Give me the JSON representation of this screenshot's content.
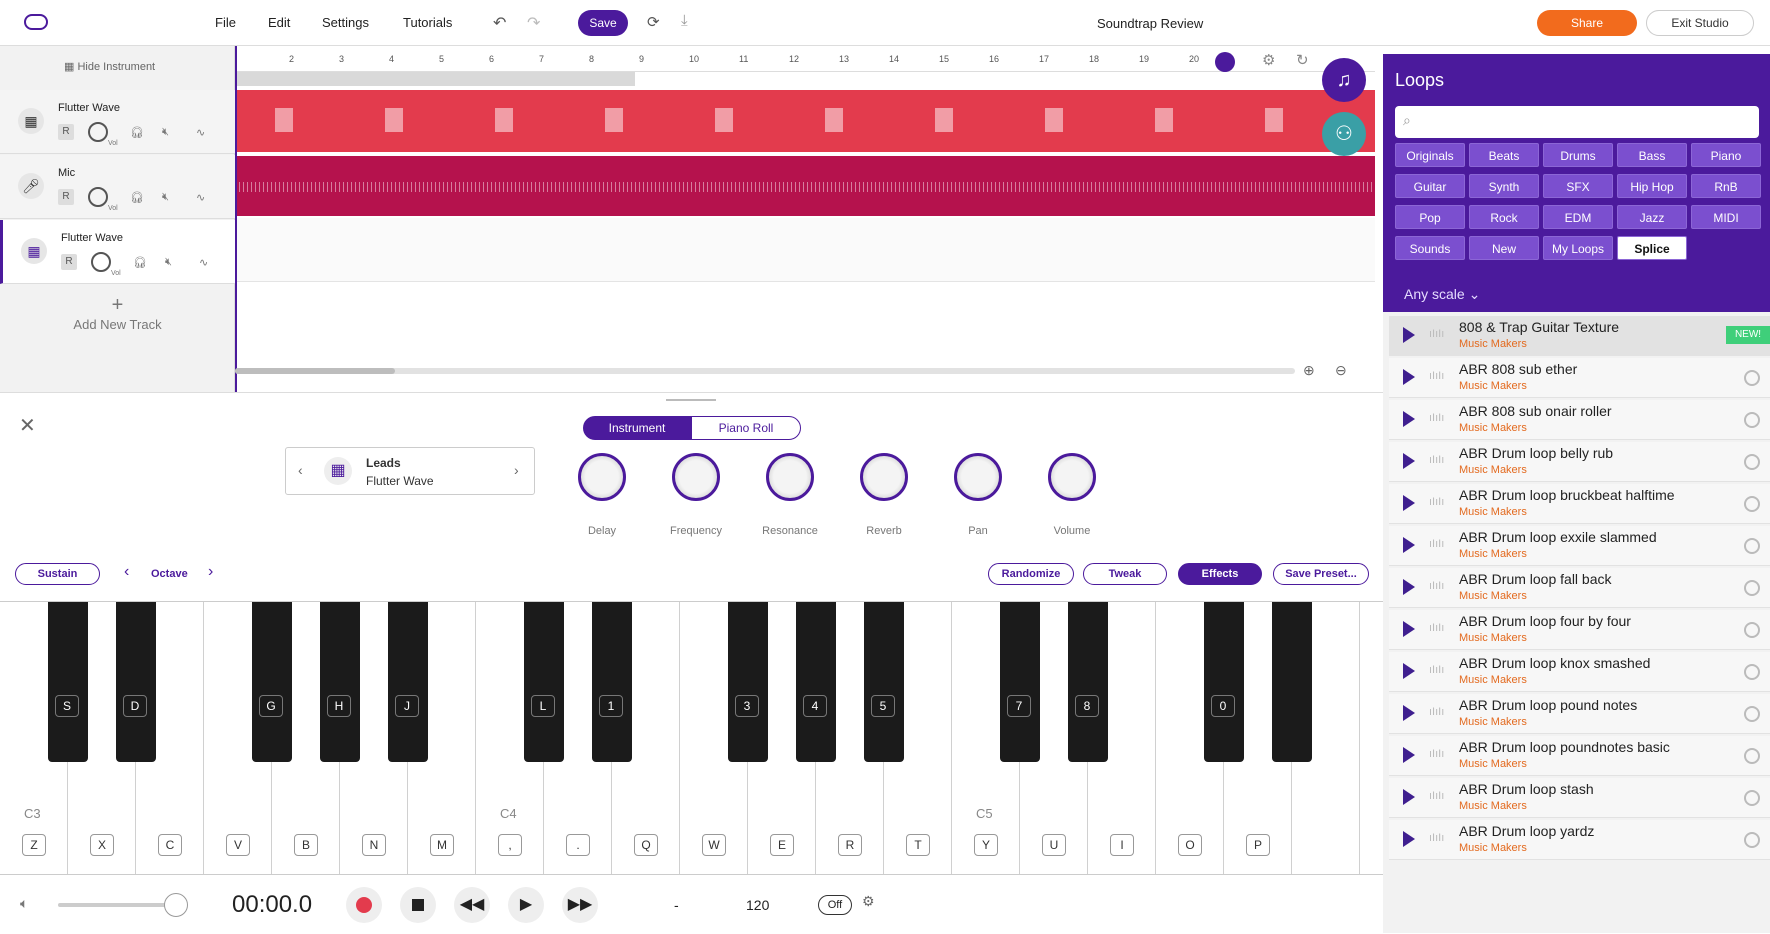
{
  "menu": {
    "file": "File",
    "edit": "Edit",
    "settings": "Settings",
    "tutorials": "Tutorials",
    "save": "Save"
  },
  "project_title": "Soundtrap Review",
  "header_buttons": {
    "share": "Share",
    "exit": "Exit Studio"
  },
  "tracks": {
    "hide_instrument": "Hide Instrument",
    "items": [
      {
        "name": "Flutter Wave",
        "r": "R",
        "vol": "Vol"
      },
      {
        "name": "Mic",
        "r": "R",
        "vol": "Vol"
      },
      {
        "name": "Flutter Wave",
        "r": "R",
        "vol": "Vol"
      }
    ],
    "add_track": "Add New Track"
  },
  "ruler": [
    "2",
    "3",
    "4",
    "5",
    "6",
    "7",
    "8",
    "9",
    "10",
    "11",
    "12",
    "13",
    "14",
    "15",
    "16",
    "17",
    "18",
    "19",
    "20"
  ],
  "loops": {
    "title": "Loops",
    "search_placeholder": "",
    "chips": [
      "Originals",
      "Beats",
      "Drums",
      "Bass",
      "Piano",
      "Guitar",
      "Synth",
      "SFX",
      "Hip Hop",
      "RnB",
      "Pop",
      "Rock",
      "EDM",
      "Jazz",
      "MIDI",
      "Sounds",
      "New",
      "My Loops",
      "Splice"
    ],
    "scale": "Any scale",
    "new_tag": "NEW!",
    "items": [
      {
        "name": "808 & Trap Guitar Texture",
        "artist": "Music Makers"
      },
      {
        "name": "ABR 808 sub ether",
        "artist": "Music Makers"
      },
      {
        "name": "ABR 808 sub onair roller",
        "artist": "Music Makers"
      },
      {
        "name": "ABR Drum loop belly rub",
        "artist": "Music Makers"
      },
      {
        "name": "ABR Drum loop bruckbeat halftime",
        "artist": "Music Makers"
      },
      {
        "name": "ABR Drum loop exxile slammed",
        "artist": "Music Makers"
      },
      {
        "name": "ABR Drum loop fall back",
        "artist": "Music Makers"
      },
      {
        "name": "ABR Drum loop four by four",
        "artist": "Music Makers"
      },
      {
        "name": "ABR Drum loop knox smashed",
        "artist": "Music Makers"
      },
      {
        "name": "ABR Drum loop pound notes",
        "artist": "Music Makers"
      },
      {
        "name": "ABR Drum loop poundnotes basic",
        "artist": "Music Makers"
      },
      {
        "name": "ABR Drum loop stash",
        "artist": "Music Makers"
      },
      {
        "name": "ABR Drum loop yardz",
        "artist": "Music Makers"
      }
    ]
  },
  "instrument": {
    "tab_instrument": "Instrument",
    "tab_piano_roll": "Piano Roll",
    "preset_category": "Leads",
    "preset_name": "Flutter Wave",
    "knobs": [
      "Delay",
      "Frequency",
      "Resonance",
      "Reverb",
      "Pan",
      "Volume"
    ],
    "sustain": "Sustain",
    "octave": "Octave",
    "randomize": "Randomize",
    "tweak": "Tweak",
    "effects": "Effects",
    "save_preset": "Save Preset..."
  },
  "piano": {
    "black_keys": [
      "S",
      "D",
      "",
      "G",
      "H",
      "J",
      "",
      "L",
      "1",
      "",
      "3",
      "4",
      "5",
      "",
      "7",
      "8",
      "",
      "0",
      "",
      ""
    ],
    "white_keys": [
      "Z",
      "X",
      "C",
      "V",
      "B",
      "N",
      "M",
      ",",
      ".",
      "Q",
      "W",
      "E",
      "R",
      "T",
      "Y",
      "U",
      "I",
      "O",
      "P",
      ""
    ],
    "octave_labels": [
      "C3",
      "C4",
      "C5"
    ]
  },
  "transport": {
    "time": "00:00.0",
    "signature": "-",
    "tempo": "120",
    "metronome": "Off"
  },
  "colors": {
    "accent": "#4b1a9c",
    "share": "#f26b1d",
    "clip_synth": "#e33b4d",
    "clip_mic": "#b5124d",
    "loop_artist": "#e36a1f"
  }
}
